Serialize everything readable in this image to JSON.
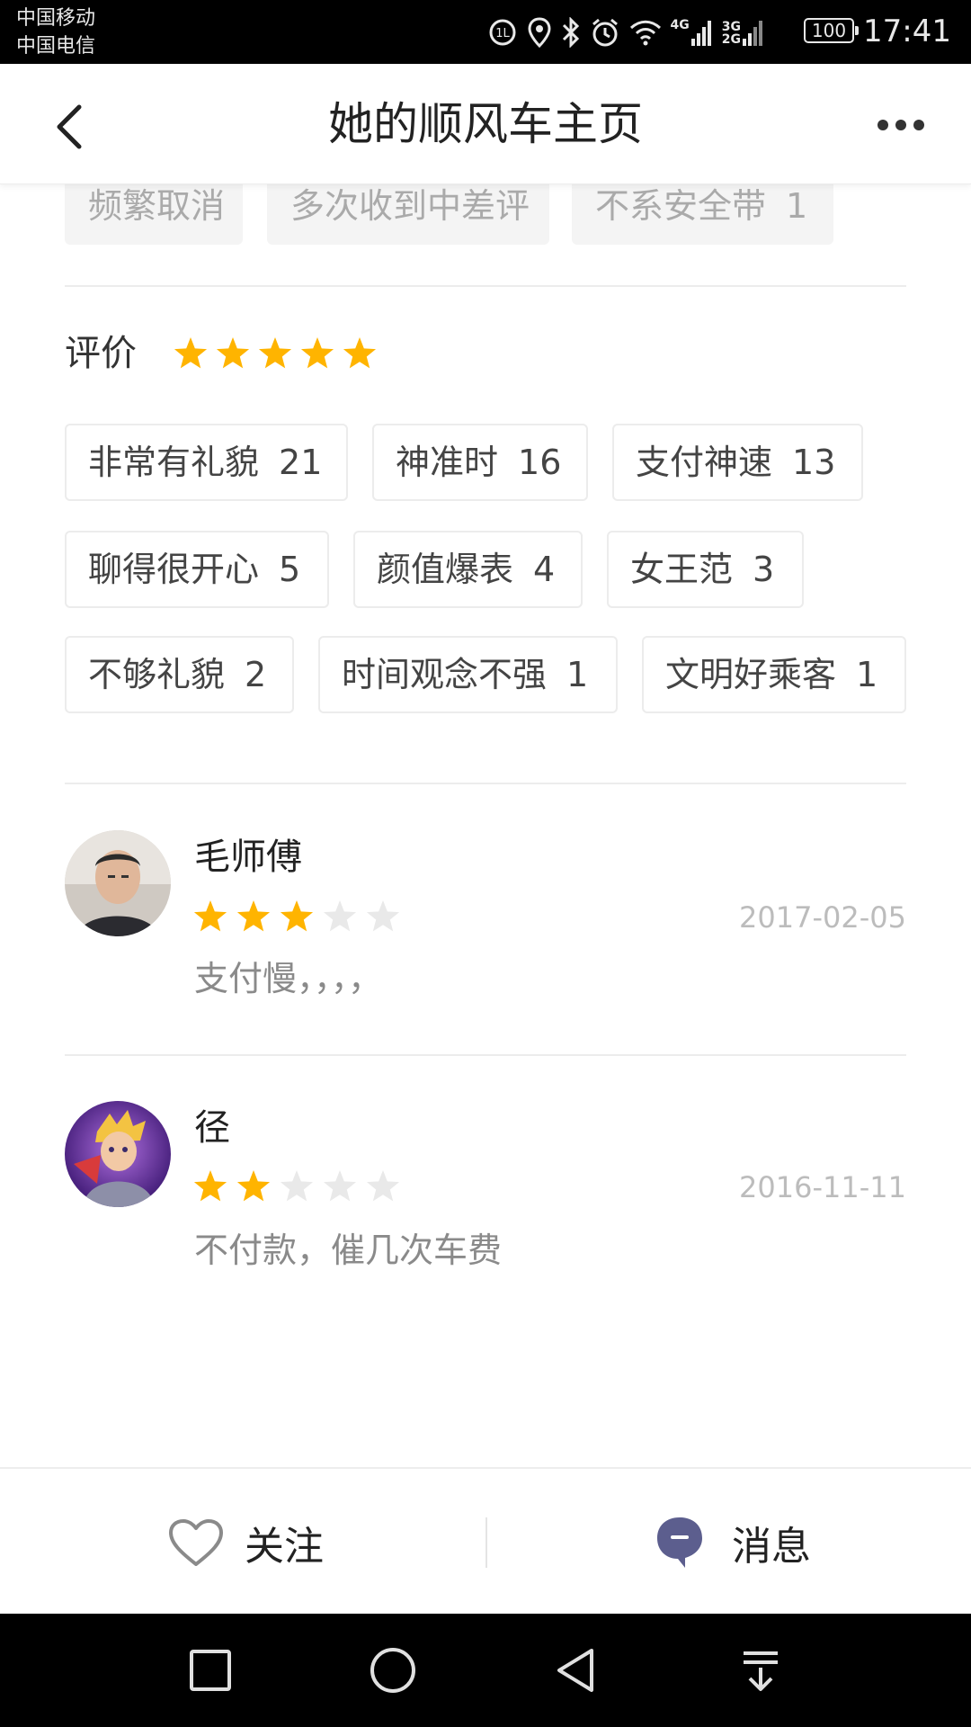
{
  "status_bar": {
    "carrier_1": "中国移动",
    "carrier_2": "中国电信",
    "net_1": "4G",
    "net_2_top": "3G",
    "net_2_bottom": "2G",
    "battery": "100",
    "time": "17:41"
  },
  "header": {
    "title": "她的顺风车主页",
    "back_icon": "chevron-left-icon",
    "more_icon": "more-dots-icon"
  },
  "warning_tags": [
    {
      "label": "频繁取消",
      "count": ""
    },
    {
      "label": "多次收到中差评",
      "count": ""
    },
    {
      "label": "不系安全带",
      "count": "1"
    }
  ],
  "rating": {
    "label": "评价",
    "stars": 5,
    "star_color": "#FFB400",
    "empty_star_color": "#E9E9E9"
  },
  "rating_tags": [
    {
      "label": "非常有礼貌",
      "count": "21"
    },
    {
      "label": "神准时",
      "count": "16"
    },
    {
      "label": "支付神速",
      "count": "13"
    },
    {
      "label": "聊得很开心",
      "count": "5"
    },
    {
      "label": "颜值爆表",
      "count": "4"
    },
    {
      "label": "女王范",
      "count": "3"
    },
    {
      "label": "不够礼貌",
      "count": "2"
    },
    {
      "label": "时间观念不强",
      "count": "1"
    },
    {
      "label": "文明好乘客",
      "count": "1"
    }
  ],
  "reviews": [
    {
      "name": "毛师傅",
      "stars": 3,
      "date": "2017-02-05",
      "text": "支付慢，，，，"
    },
    {
      "name": "径",
      "stars": 2,
      "date": "2016-11-11",
      "text": "不付款，催几次车费"
    }
  ],
  "bottom_bar": {
    "follow_label": "关注",
    "follow_icon": "heart-icon",
    "message_label": "消息",
    "message_icon": "chat-bubble-icon"
  },
  "nav_bar": {
    "icons": [
      "square-icon",
      "circle-icon",
      "triangle-back-icon",
      "pull-down-icon"
    ]
  }
}
